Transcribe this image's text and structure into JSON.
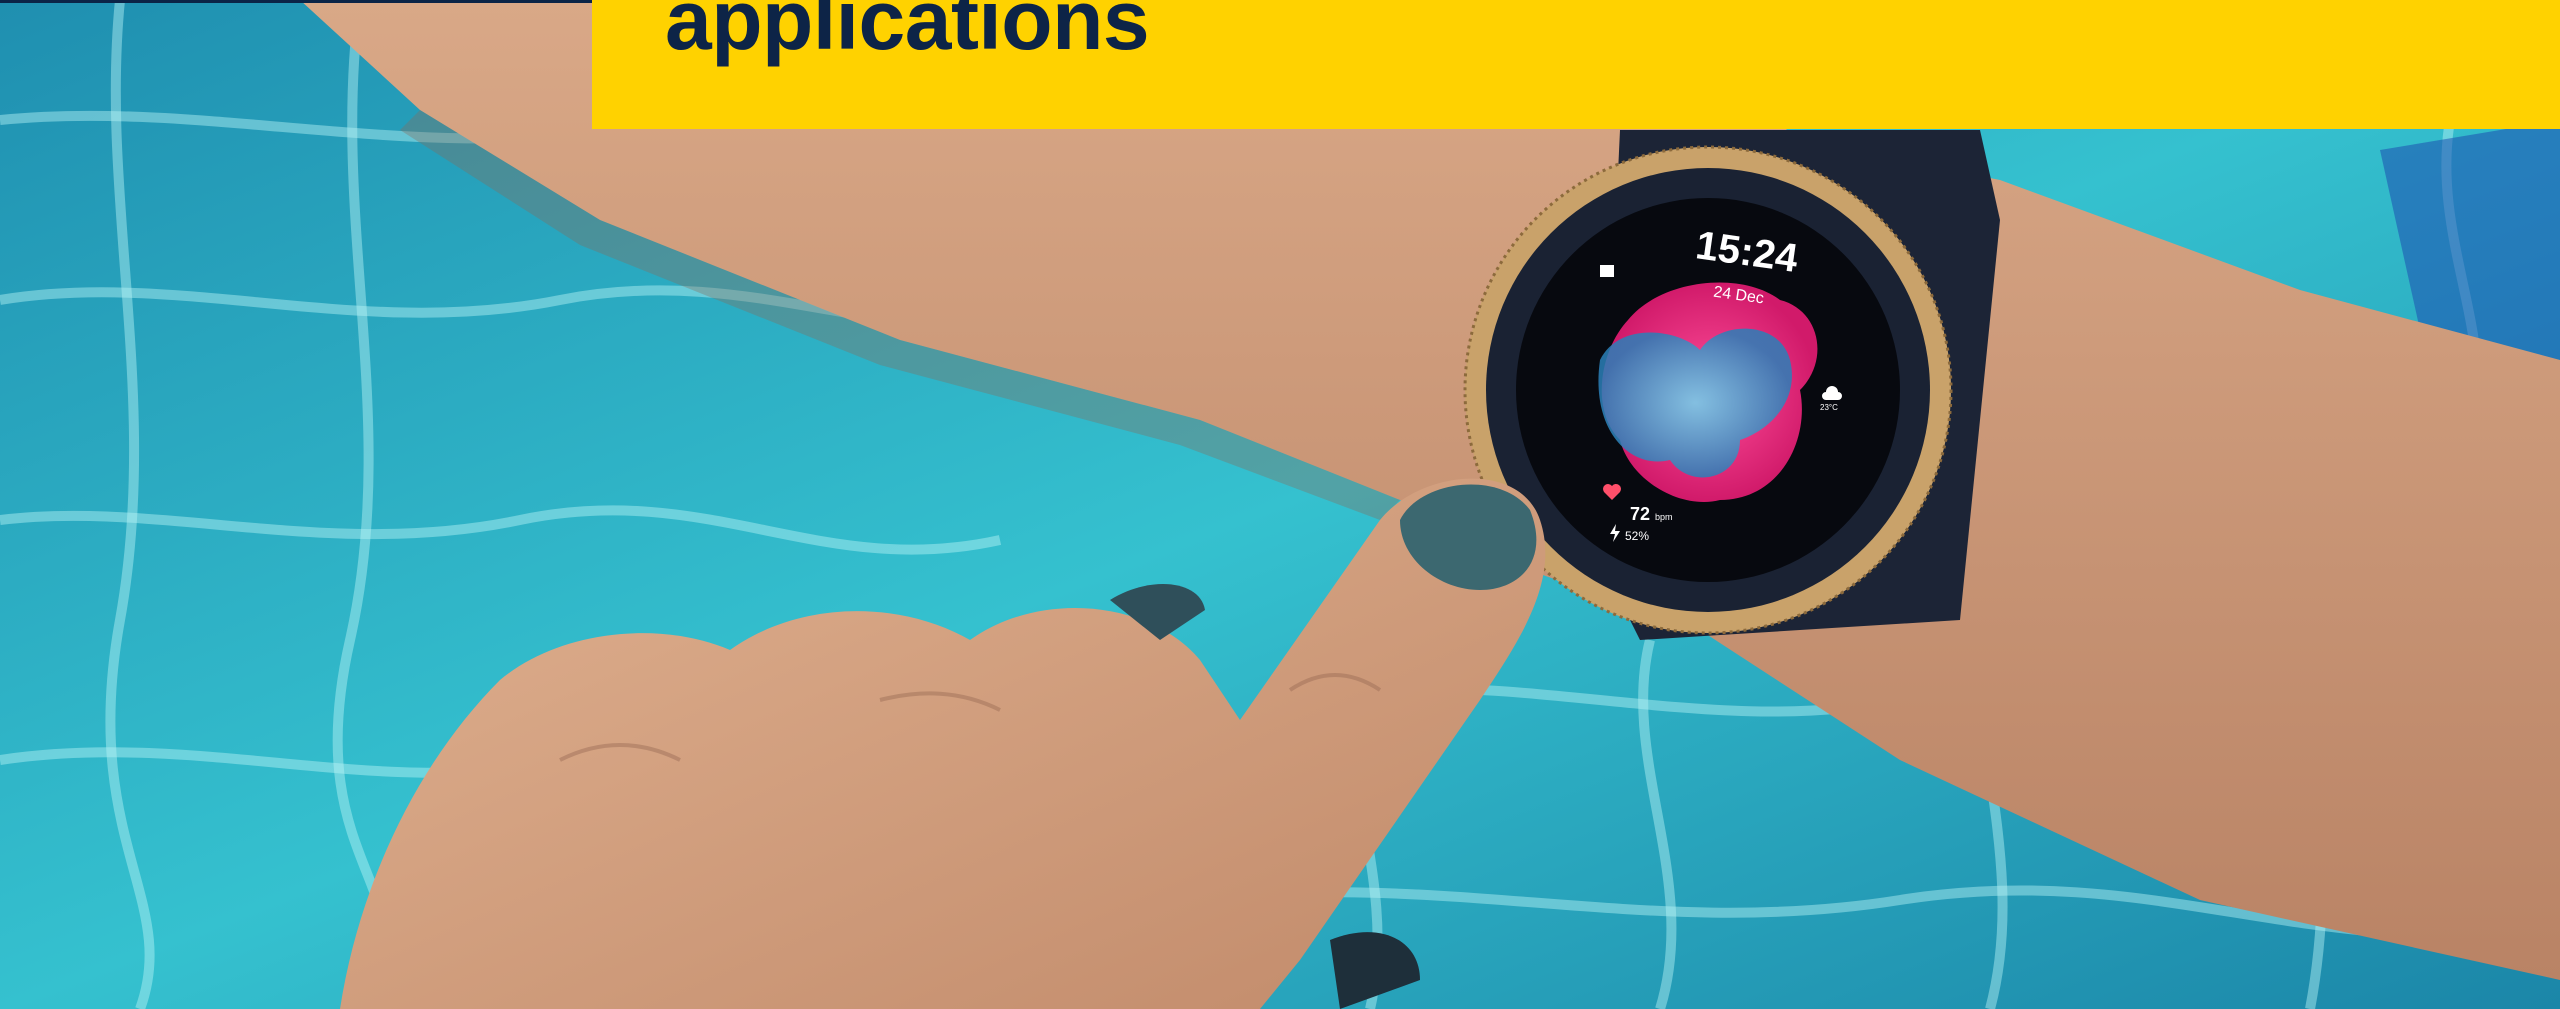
{
  "banner": {
    "title": "applications"
  },
  "watch_face": {
    "time": "15:24",
    "date": "24 Dec",
    "heart_rate": "72",
    "heart_rate_unit": "bpm",
    "battery": "52%",
    "weather": "23°C"
  },
  "colors": {
    "banner_bg": "#ffd200",
    "banner_text": "#0d2447",
    "pool_water": "#2bb6c7",
    "watch_bezel": "#c9a26a"
  }
}
